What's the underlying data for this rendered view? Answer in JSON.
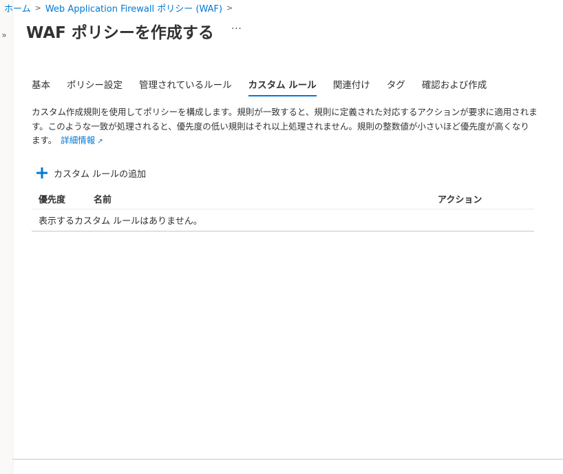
{
  "breadcrumb": {
    "home": "ホーム",
    "parent": "Web Application Firewall ポリシー (WAF)",
    "sep": ">"
  },
  "page": {
    "title": "WAF ポリシーを作成する",
    "more": "···"
  },
  "tabs": [
    {
      "label": "基本"
    },
    {
      "label": "ポリシー設定"
    },
    {
      "label": "管理されているルール"
    },
    {
      "label": "カスタム ルール",
      "active": true
    },
    {
      "label": "関連付け"
    },
    {
      "label": "タグ"
    },
    {
      "label": "確認および作成"
    }
  ],
  "description": {
    "text": "カスタム作成規則を使用してポリシーを構成します。規則が一致すると、規則に定義された対応するアクションが要求に適用されます。このような一致が処理されると、優先度の低い規則はそれ以上処理されません。規則の整数値が小さいほど優先度が高くなります。",
    "link": "詳細情報"
  },
  "toolbar": {
    "add_label": "カスタム ルールの追加"
  },
  "table": {
    "columns": [
      "優先度",
      "名前",
      "アクション"
    ],
    "empty_message": "表示するカスタム ルールはありません。"
  },
  "colors": {
    "accent": "#0078d4",
    "text": "#323130"
  }
}
